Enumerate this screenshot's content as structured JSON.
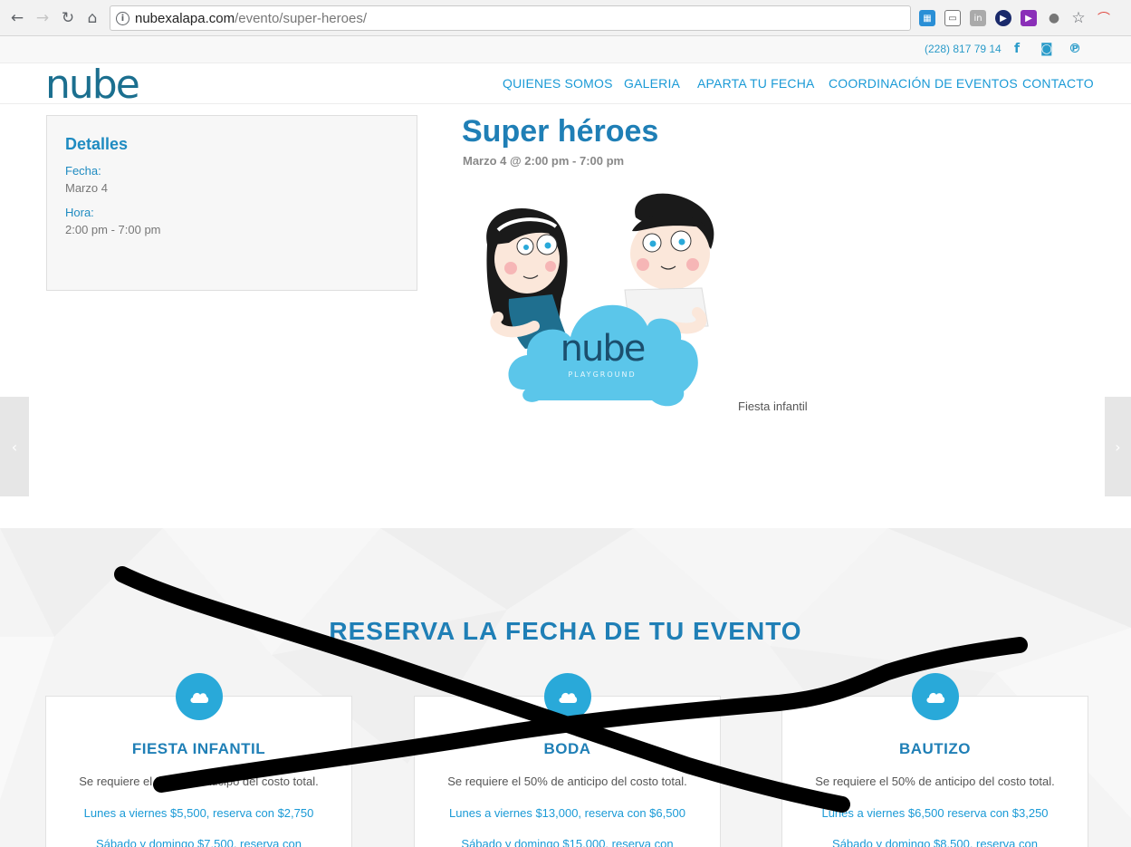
{
  "browser": {
    "url_domain": "nubexalapa.com",
    "url_path": "/evento/super-heroes/"
  },
  "topbar": {
    "phone": "(228) 817 79 14"
  },
  "header": {
    "logo": "nube",
    "menu": [
      "QUIENES SOMOS",
      "GALERIA",
      "APARTA TU FECHA",
      "COORDINACIÓN DE EVENTOS",
      "CONTACTO"
    ]
  },
  "details": {
    "title": "Detalles",
    "fecha_label": "Fecha:",
    "fecha_value": "Marzo 4",
    "hora_label": "Hora:",
    "hora_value": "2:00 pm - 7:00 pm"
  },
  "event": {
    "title": "Super héroes",
    "date": "Marzo 4 @ 2:00 pm - 7:00 pm",
    "logo_text": "nube",
    "logo_sub": "PLAYGROUND",
    "caption": "Fiesta infantil"
  },
  "reserve": {
    "title": "RESERVA LA FECHA DE TU EVENTO",
    "cards": [
      {
        "title": "FIESTA INFANTIL",
        "requirement": "Se requiere el 50% de anticipo del costo total.",
        "weekday": "Lunes a viernes $5,500, reserva con $2,750",
        "weekend": "Sábado y domingo $7,500, reserva con"
      },
      {
        "title": "BODA",
        "requirement": "Se requiere el 50% de anticipo del costo total.",
        "weekday": "Lunes a viernes $13,000, reserva con $6,500",
        "weekend": "Sábado y domingo $15,000, reserva con"
      },
      {
        "title": "BAUTIZO",
        "requirement": "Se requiere el 50% de anticipo del costo total.",
        "weekday": "Lunes a viernes $6,500  reserva con $3,250",
        "weekend": "Sábado y domingo $8,500, reserva con"
      }
    ]
  },
  "colors": {
    "brand_blue": "#1f7fb6",
    "accent_cyan": "#29a9d9",
    "link": "#1a9ad6"
  }
}
